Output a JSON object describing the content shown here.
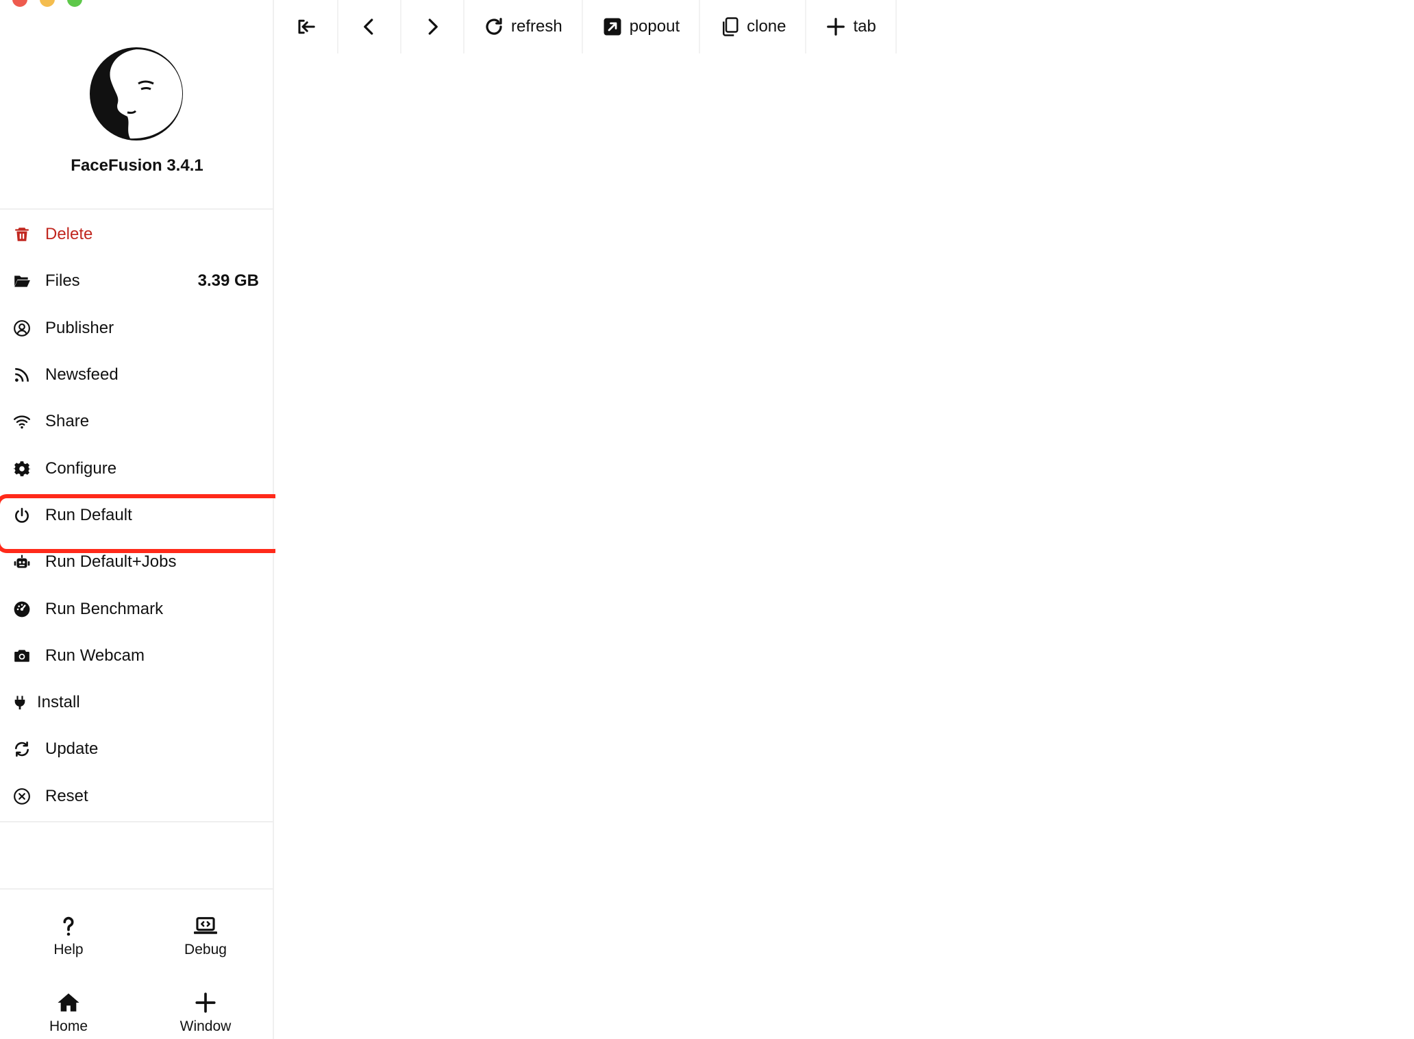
{
  "window": {
    "traffic_colors": [
      "#ee5b4e",
      "#f4bd4f",
      "#5ec84a"
    ]
  },
  "toolbar": {
    "back_label": "",
    "refresh": "refresh",
    "popout": "popout",
    "clone": "clone",
    "tab": "tab"
  },
  "sidebar": {
    "app_title": "FaceFusion 3.4.1",
    "items": [
      {
        "label": "Delete",
        "icon": "trash-icon"
      },
      {
        "label": "Files",
        "value": "3.39 GB",
        "icon": "folder-open-icon"
      },
      {
        "label": "Publisher",
        "icon": "user-circle-icon"
      },
      {
        "label": "Newsfeed",
        "icon": "rss-icon"
      },
      {
        "label": "Share",
        "icon": "wifi-icon"
      },
      {
        "label": "Configure",
        "icon": "gear-icon"
      },
      {
        "label": "Run Default",
        "icon": "power-icon"
      },
      {
        "label": "Run Default+Jobs",
        "icon": "robot-icon"
      },
      {
        "label": "Run Benchmark",
        "icon": "gauge-icon"
      },
      {
        "label": "Run Webcam",
        "icon": "camera-icon"
      },
      {
        "label": "Install",
        "icon": "plug-icon"
      },
      {
        "label": "Update",
        "icon": "refresh-icon"
      },
      {
        "label": "Reset",
        "icon": "close-circle-icon"
      }
    ],
    "bottom": {
      "help": "Help",
      "debug": "Debug",
      "home": "Home",
      "window": "Window"
    }
  },
  "colors": {
    "danger": "#c1271f",
    "highlight": "#ff2a1a"
  }
}
